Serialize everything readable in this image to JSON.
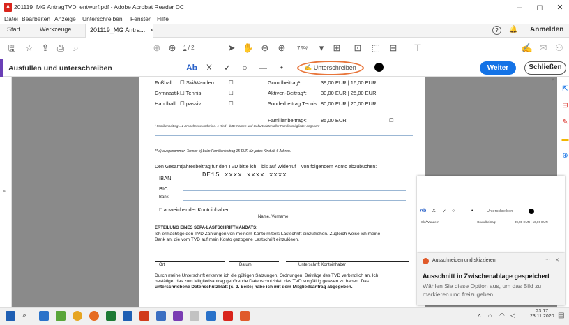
{
  "window": {
    "title": "201119_MG AntragTVD_entwurf.pdf - Adobe Acrobat Reader DC",
    "minimize": "–",
    "restore": "◻",
    "close": "✕"
  },
  "menu": [
    "Datei",
    "Bearbeiten",
    "Anzeige",
    "Unterschreiben",
    "Fenster",
    "Hilfe"
  ],
  "tabs": {
    "start": "Start",
    "werkzeuge": "Werkzeuge",
    "doc": "201119_MG Antra...",
    "doc_close": "×",
    "help": "?",
    "anmelden": "Anmelden"
  },
  "toolbar": {
    "page_current": "1",
    "page_total": "/ 2",
    "zoom": "75%"
  },
  "fillsign": {
    "title": "Ausfüllen und unterschreiben",
    "textfield": "Ab",
    "cross": "X",
    "check": "✓",
    "circle": "○",
    "dash": "—",
    "dot": "•",
    "sign_label": "Unterschreiben",
    "weiter": "Weiter",
    "schliessen": "Schließen"
  },
  "form": {
    "sports": [
      {
        "left": "Fußball",
        "mid": "Ski/Wandern",
        "beitrag": "Grundbeitrag¹:",
        "price": "39,00 EUR | 16,00 EUR"
      },
      {
        "left": "Gymnastik",
        "mid": "Tennis",
        "beitrag": "Aktiven-Beitrag*:",
        "price": "30,00 EUR | 25,00 EUR"
      },
      {
        "left": "Handball",
        "mid": "passiv",
        "beitrag": "Sonderbeitrag Tennis:",
        "price": "80,00 EUR | 20,00 EUR"
      }
    ],
    "familien_label": "Familienbeitrag¹:",
    "familien_price": "85,00 EUR",
    "familien_note": "¹ Familienbeitrag = 2 Erwachsene und mind. 1 Kind – bitte Namen und Geburtsdaten aller Familienmitglieder angeben!",
    "tennis_note": "** a) ausgenommen Tennis; b) beim Familienbeitrag 15 EUR für jedes Kind ab 6 Jahren.",
    "bank_intro": "Den Gesamtjahresbeitrag für den TVD bitte ich – bis auf Widerruf – von folgendem Konto abzubuchen:",
    "iban_label": "IBAN",
    "iban_value": "DE15  xxxx  xxxx  xxxx",
    "bic_label": "BIC",
    "bank_label": "Bank",
    "abw_label": "□ abweichender Kontoinhaber:",
    "name_caption": "Name, Vorname",
    "sepa_title": "ERTEILUNG EINES SEPA-LASTSCHRIFTMANDATS:",
    "sepa_text1": "Ich ermächtige den TVD Zahlungen von meinem Konto mittels Lastschrift einzuziehen. Zugleich weise ich meine",
    "sepa_text2": "Bank an, die vom TVD auf mein Konto gezogene Lastschrift einzulösen.",
    "ort": "Ort",
    "datum": "Datum",
    "unterschrift": "Unterschrift Kontoinhaber",
    "final1": "Durch meine Unterschrift erkenne ich die gültigen Satzungen, Ordnungen, Beiträge des TVD verbindlich an. Ich",
    "final2": "bestätige, das zum Mitgliedsantrag gehörende Datenschutzblatt des TVD sorgfältig gelesen zu haben. Das",
    "final3": "unterschriebene Datenschutzblatt (s. 2. Seite) habe ich mit dem Mitgliedsantrag abgegeben."
  },
  "thumb": {
    "sign_label": "Unterschreiben",
    "row_left": "Ski/Wandern",
    "row_mid": "Grundbeitrag:",
    "row_right": "39,00 EUR | 16,00 EUR"
  },
  "toast": {
    "app": "Ausschneiden und skizzieren",
    "title": "Ausschnitt in Zwischenablage gespeichert",
    "body": "Wählen Sie diese Option aus, um das Bild zu markieren und freizugeben",
    "more": "···",
    "close": "✕"
  },
  "clock": {
    "time": "23:17",
    "date": "23.11.2020"
  }
}
